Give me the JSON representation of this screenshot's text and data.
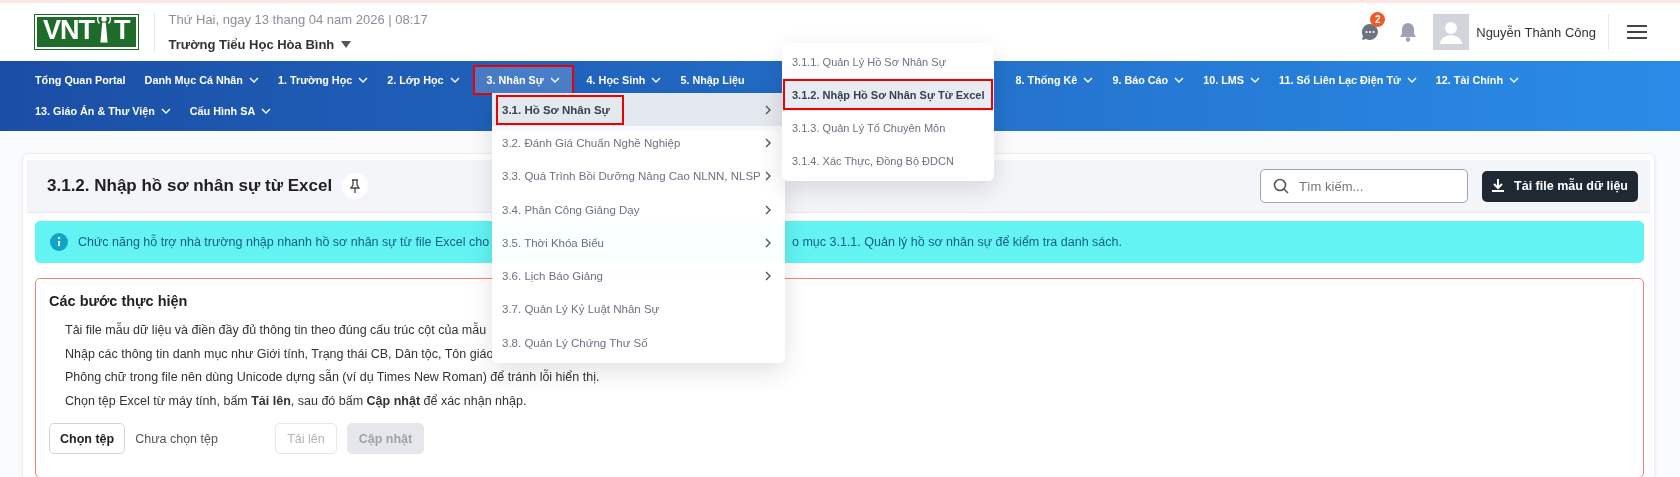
{
  "header": {
    "logo": {
      "parts": [
        "VN",
        "T",
        "T"
      ]
    },
    "date": "Thứ Hai, ngay 13 thang 04 nam 2026 | 08:17",
    "school": "Trường Tiểu Học Hòa Bình",
    "message_badge": "2",
    "user_name": "Nguyễn Thành Công"
  },
  "nav": {
    "rows": [
      [
        {
          "label": "Tổng Quan Portal",
          "has_menu": false,
          "selected": false
        },
        {
          "label": "Danh Mục Cá Nhân",
          "has_menu": true,
          "selected": false
        },
        {
          "label": "1. Trường Học",
          "has_menu": true,
          "selected": false
        },
        {
          "label": "2. Lớp Học",
          "has_menu": true,
          "selected": false
        },
        {
          "label": "3. Nhân Sự",
          "has_menu": true,
          "selected": true
        },
        {
          "label": "4. Học Sinh",
          "has_menu": true,
          "selected": false
        },
        {
          "label": "5. Nhập Liệu",
          "has_menu": false,
          "selected": false
        },
        {
          "label": "8. Thống Kê",
          "has_menu": true,
          "selected": false
        },
        {
          "label": "9. Báo Cáo",
          "has_menu": true,
          "selected": false
        },
        {
          "label": "10. LMS",
          "has_menu": true,
          "selected": false
        },
        {
          "label": "11. Sổ Liên Lạc Điện Tử",
          "has_menu": true,
          "selected": false
        },
        {
          "label": "12. Tài Chính",
          "has_menu": true,
          "selected": false
        }
      ],
      [
        {
          "label": "13. Giáo Án & Thư Viện",
          "has_menu": true,
          "selected": false
        },
        {
          "label": "Cấu Hình SA",
          "has_menu": true,
          "selected": false
        }
      ]
    ]
  },
  "menu": {
    "items": [
      {
        "label": "3.1. Hồ Sơ Nhân Sự",
        "selected": true,
        "has_submenu": true
      },
      {
        "label": "3.2. Đánh Giá Chuẩn Nghề Nghiệp",
        "selected": false,
        "has_submenu": true
      },
      {
        "label": "3.3. Quá Trình Bồi Dưỡng Nâng Cao NLNN, NLSP",
        "selected": false,
        "has_submenu": true
      },
      {
        "label": "3.4. Phân Công Giảng Dạy",
        "selected": false,
        "has_submenu": true
      },
      {
        "label": "3.5. Thời Khóa Biểu",
        "selected": false,
        "has_submenu": true
      },
      {
        "label": "3.6. Lịch Báo Giảng",
        "selected": false,
        "has_submenu": true
      },
      {
        "label": "3.7. Quản Lý Kỷ Luật Nhân Sự",
        "selected": false,
        "has_submenu": false
      },
      {
        "label": "3.8. Quản Lý Chứng Thư Số",
        "selected": false,
        "has_submenu": false
      }
    ]
  },
  "submenu": {
    "items": [
      {
        "label": "3.1.1. Quản Lý Hồ Sơ Nhân Sự",
        "selected": false
      },
      {
        "label": "3.1.2. Nhập Hồ Sơ Nhân Sự Từ Excel",
        "selected": true
      },
      {
        "label": "3.1.3. Quản Lý Tổ Chuyên Môn",
        "selected": false
      },
      {
        "label": "3.1.4. Xác Thực, Đồng Bộ ĐDCN",
        "selected": false
      }
    ]
  },
  "page": {
    "title": "3.1.2. Nhập hồ sơ nhân sự từ Excel",
    "search_placeholder": "Tìm kiếm...",
    "download_button": "Tải file mẫu dữ liệu",
    "info_parts": [
      "Chức năng hỗ trợ nhà trường nhập nhanh hồ sơ nhân sự từ file Excel cho",
      "o mục 3.1.1. Quản lý hồ sơ nhân sự để kiểm tra danh sách."
    ],
    "steps": {
      "title": "Các bước thực hiện",
      "lines": [
        "Tải file mẫu dữ liệu và điền đầy đủ thông tin theo đúng cấu trúc cột của mẫu",
        "Nhập các thông tin danh mục như Giới tính, Trạng thái CB, Dân tộc, Tôn giáo,",
        "Phông chữ trong file nên dùng Unicode dựng sẵn (ví dụ Times New Roman) để tránh lỗi hiển thị.",
        "Chọn tệp Excel từ máy tính, bấm **Tải lên**, sau đó bấm **Cập nhật** để xác nhận nhập."
      ]
    },
    "file_button": "Chọn tệp",
    "file_status": "Chưa chọn tệp",
    "actions": [
      {
        "label": "Tải lên",
        "kind": "outline",
        "disabled": true
      },
      {
        "label": "Cập nhật",
        "kind": "filled",
        "disabled": true
      }
    ]
  }
}
